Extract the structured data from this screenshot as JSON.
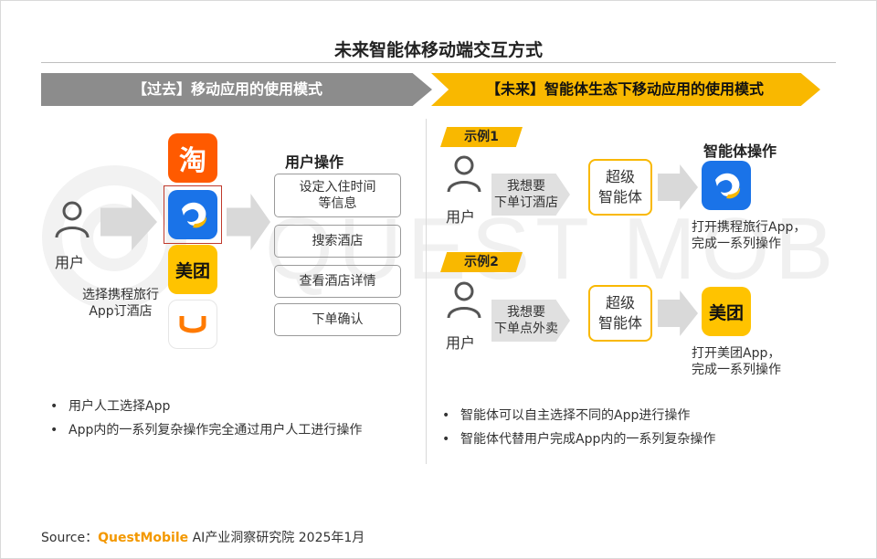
{
  "title": "未来智能体移动端交互方式",
  "banners": {
    "past": "【过去】移动应用的使用模式",
    "future": "【未来】智能体生态下移动应用的使用模式"
  },
  "past": {
    "user_label": "用户",
    "apps": [
      {
        "name": "taobao-app-icon",
        "glyph": "淘"
      },
      {
        "name": "ctrip-app-icon",
        "glyph": ""
      },
      {
        "name": "meituan-app-icon",
        "glyph": "美团"
      },
      {
        "name": "didi-app-icon",
        "glyph": ""
      }
    ],
    "caption": "选择携程旅行App订酒店",
    "caption_line1": "选择携程旅行",
    "caption_line2": "App订酒店",
    "ops_heading": "用户操作",
    "ops": [
      {
        "line1": "设定入住时间",
        "line2": "等信息"
      },
      {
        "line1": "搜索酒店",
        "line2": ""
      },
      {
        "line1": "查看酒店详情",
        "line2": ""
      },
      {
        "line1": "下单确认",
        "line2": ""
      }
    ],
    "bullets": [
      "用户人工选择App",
      "App内的一系列复杂操作完全通过用户人工进行操作"
    ]
  },
  "future": {
    "agent_ops_heading": "智能体操作",
    "examples": [
      {
        "tag": "示例1",
        "user_label": "用户",
        "speech_line1": "我想要",
        "speech_line2": "下单订酒店",
        "agent_line1": "超级",
        "agent_line2": "智能体",
        "result_line1": "打开携程旅行App，",
        "result_line2": "完成一系列操作",
        "app": "ctrip-app-icon"
      },
      {
        "tag": "示例2",
        "user_label": "用户",
        "speech_line1": "我想要",
        "speech_line2": "下单点外卖",
        "agent_line1": "超级",
        "agent_line2": "智能体",
        "result_line1": "打开美团App，",
        "result_line2": "完成一系列操作",
        "app": "meituan-app-icon",
        "app_glyph": "美团"
      }
    ],
    "bullets": [
      "智能体可以自主选择不同的App进行操作",
      "智能体代替用户完成App内的一系列复杂操作"
    ]
  },
  "watermark": "QUEST MOBILE",
  "source": {
    "prefix": "Source：",
    "brand": "QuestMobile",
    "suffix": " AI产业洞察研究院 2025年1月"
  },
  "colors": {
    "accent_yellow": "#f9b800",
    "past_gray": "#8c8c8c",
    "brand_orange": "#f39800",
    "ctrip_blue": "#1a73e8",
    "taobao_orange": "#ff5a00",
    "meituan_yellow": "#ffc300"
  }
}
